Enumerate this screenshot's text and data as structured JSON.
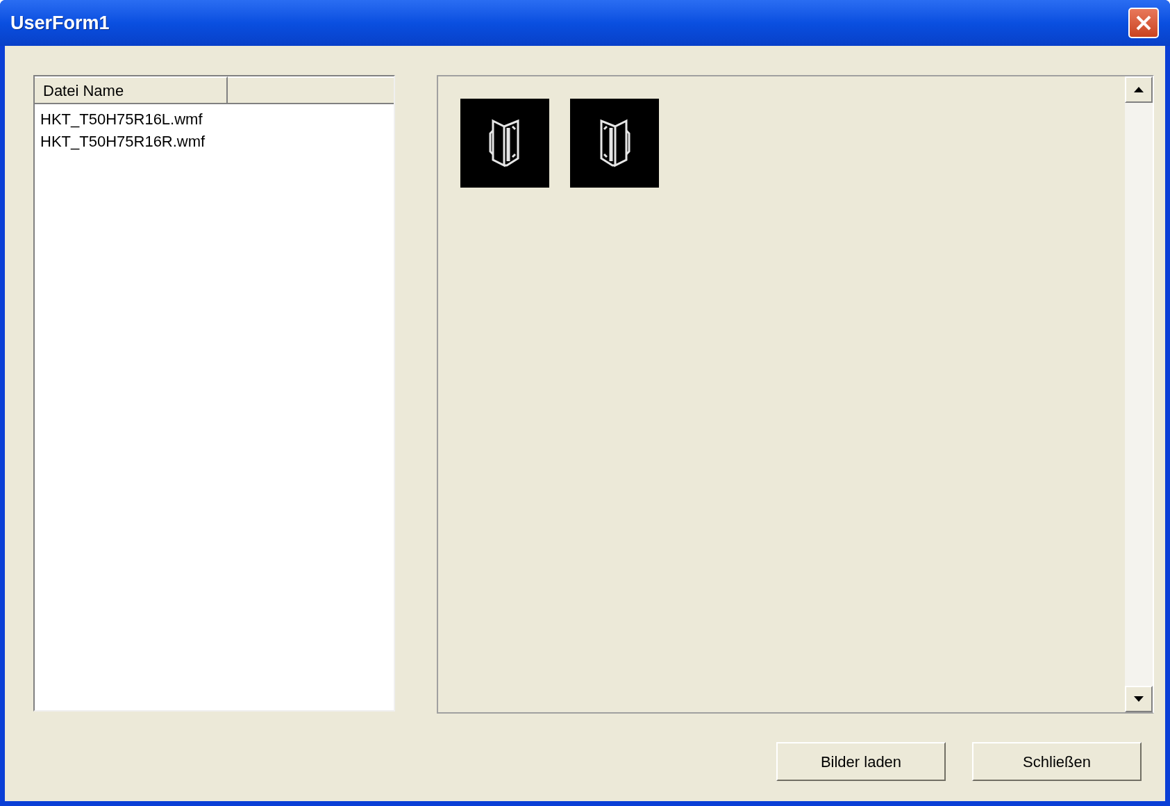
{
  "window": {
    "title": "UserForm1"
  },
  "file_list": {
    "columns": [
      "Datei Name"
    ],
    "rows": [
      "HKT_T50H75R16L.wmf",
      "HKT_T50H75R16R.wmf"
    ]
  },
  "thumbnails": [
    {
      "kind": "left"
    },
    {
      "kind": "right"
    }
  ],
  "buttons": [
    "Bilder laden",
    "Schließen"
  ]
}
